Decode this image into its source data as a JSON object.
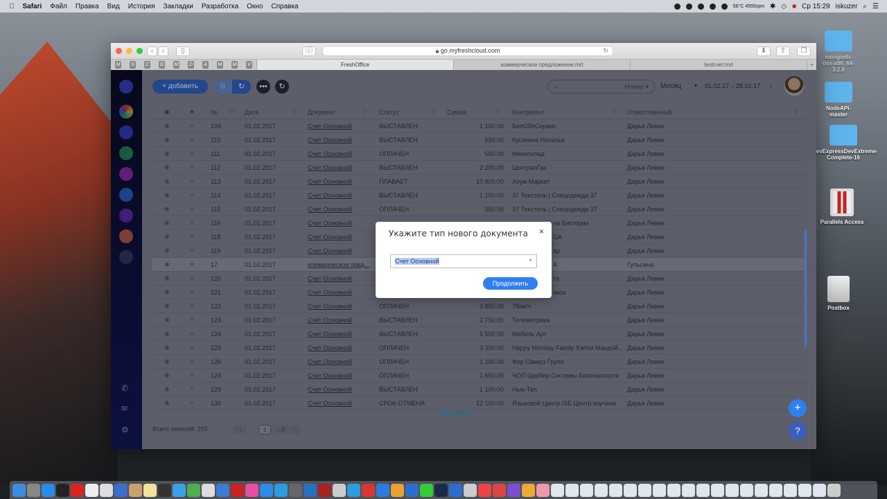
{
  "menubar": {
    "apple": "",
    "app": "Safari",
    "items": [
      "Файл",
      "Правка",
      "Вид",
      "История",
      "Закладки",
      "Разработка",
      "Окно",
      "Справка"
    ],
    "temp": "56°C 4555rpm",
    "clock": "Ср 15:29",
    "user": "iskuzer"
  },
  "browser": {
    "url": "go.myfreshcloud.com",
    "favorites": [
      "M",
      "S",
      "C",
      "G",
      "M",
      "D",
      "A",
      "M",
      "M",
      "V"
    ],
    "tabs": [
      "FreshOffice",
      "коммерческое предложение.mrt",
      "testсчет.mrt"
    ]
  },
  "toolbar": {
    "add_label": "+ добавить",
    "search_field": "Номер ▾",
    "period": "Месяц",
    "period_arrow": "▾",
    "date_range": "01.02.17  –  28.02.17"
  },
  "table": {
    "headers": [
      "№",
      "Дата",
      "Документ",
      "Статус",
      "Сумма",
      "Контрагент",
      "Ответственный"
    ],
    "rows": [
      [
        "109",
        "01.02.2017",
        "Счет Основной",
        "ВЫСТАВЛЕН",
        "1 100.00",
        "БелОблСервис",
        "Дарья Левин"
      ],
      [
        "110",
        "01.02.2017",
        "Счет Основной",
        "ВЫСТАВЛЕН",
        "550.00",
        "Кусакина Наталья",
        "Дарья Левин"
      ],
      [
        "111",
        "01.02.2017",
        "Счет Основной",
        "ОПЛАЧЕН",
        "550.00",
        "Минисклад",
        "Дарья Левин"
      ],
      [
        "112",
        "01.02.2017",
        "Счет Основной",
        "ВЫСТАВЛЕН",
        "2 200.00",
        "ЦентралГаз",
        "Дарья Левин"
      ],
      [
        "113",
        "01.02.2017",
        "Счет Основной",
        "ПЛАВАЕТ",
        "10 800.00",
        "Хоум Маркет",
        "Дарья Левин"
      ],
      [
        "114",
        "01.02.2017",
        "Счет Основной",
        "ВЫСТАВЛЕН",
        "1 100.00",
        "37 Текстиль | Спецодежда 37",
        "Дарья Левин"
      ],
      [
        "115",
        "01.02.2017",
        "Счет Основной",
        "ОПЛАЧЕН",
        "550.00",
        "37 Текстиль | Спецодежда 37",
        "Дарья Левин"
      ],
      [
        "116",
        "01.02.2017",
        "Счет Основной",
        "",
        "",
        "на Виктории",
        "Дарья Левин"
      ],
      [
        "118",
        "01.02.2017",
        "Счет Основной",
        "",
        "",
        "GA",
        "Дарья Левин"
      ],
      [
        "119",
        "01.02.2017",
        "Счет Основной",
        "",
        "",
        "ар",
        "Дарья Левин"
      ],
      [
        "17",
        "01.02.2017",
        "коммерческое пред...",
        "",
        "",
        "А",
        "Гульсина"
      ],
      [
        "120",
        "01.02.2017",
        "Счет Основной",
        "",
        "",
        "та",
        "Дарья Левин"
      ],
      [
        "121",
        "01.02.2017",
        "Счет Основной",
        "",
        "",
        "акси",
        "Дарья Левин"
      ],
      [
        "122",
        "01.02.2017",
        "Счет Основной",
        "ОПЛАЧЕН",
        "3 850.00",
        "78км/ч",
        "Дарья Левин"
      ],
      [
        "123",
        "01.02.2017",
        "Счет Основной",
        "ВЫСТАВЛЕН",
        "2 750.00",
        "Телеметрика",
        "Дарья Левин"
      ],
      [
        "124",
        "01.02.2017",
        "Счет Основной",
        "ВЫСТАВЛЕН",
        "5 500.00",
        "Мебель Арт",
        "Дарья Левин"
      ],
      [
        "125",
        "01.02.2017",
        "Счет Основной",
        "ОПЛАЧЕН",
        "3 300.00",
        "Happy Monday Family Хэппи Мандэй...",
        "Дарья Левин"
      ],
      [
        "126",
        "01.02.2017",
        "Счет Основной",
        "ОПЛАЧЕН",
        "1 100.00",
        "Фор Скверз Групп",
        "Дарья Левин"
      ],
      [
        "128",
        "01.02.2017",
        "Счет Основной",
        "ОПЛАЧЕН",
        "1 650.00",
        "ЧОП Цербер Системы Безопасности",
        "Дарья Левин"
      ],
      [
        "129",
        "01.02.2017",
        "Счет Основной",
        "ВЫСТАВЛЕН",
        "1 100.00",
        "Нью-Тел",
        "Дарья Левин"
      ],
      [
        "130",
        "01.02.2017",
        "Счет Основной",
        "СРОК-ОТМЕНА",
        "12 100.00",
        "Языковой Центр ISE Центр изучени",
        "Дарья Левин"
      ]
    ],
    "total": "2 898 396,12"
  },
  "footer": {
    "records": "Всего записей: 255",
    "page_current": "1",
    "page_last": "...6"
  },
  "modal": {
    "title": "Укажите тип нового документа",
    "close": "×",
    "selected": "Счет Основной",
    "continue": "Продолжить"
  },
  "fab": {
    "add": "+",
    "help": "?"
  },
  "desktop": [
    "mongodb-osx-x86_64-3.2.8",
    "NodeAPI-master",
    "DevExpressDevExtreme-Complete-16",
    "Parallels Access",
    "Postbox"
  ],
  "colors": {
    "accent": "#2f7ff0",
    "total": "#2aa0c8"
  },
  "dock_colors": [
    "#3b8de0",
    "#888",
    "#2a8be8",
    "#222",
    "#d22",
    "#eee",
    "#ddd",
    "#3a6fd0",
    "#c9a36a",
    "#f2e39a",
    "#333",
    "#3aa0e8",
    "#4caf50",
    "#ddd",
    "#3b7bd4",
    "#c22",
    "#e84fa0",
    "#2e8ce8",
    "#2a9de0",
    "#666",
    "#2b6fc0",
    "#a22",
    "#ccc",
    "#2a9de0",
    "#d33",
    "#2a7de0",
    "#e8a030",
    "#2a6fd0",
    "#3c3",
    "#1a2a4a",
    "#2a6fd0",
    "#ccc",
    "#e44",
    "#d44",
    "#7a4fd0",
    "#ea3",
    "#e9a"
  ]
}
